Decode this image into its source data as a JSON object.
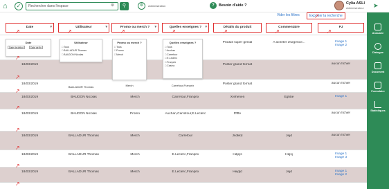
{
  "topbar": {
    "search_placeholder": "Rechercher dans l'espace",
    "admin_label": "Administration",
    "help_label": "Besoin d'aide ?",
    "user_name": "Cylia ASLI",
    "user_role": "Administrateur"
  },
  "links": {
    "reset": "Vider les filtres",
    "export": "Exporter la recherche"
  },
  "columns": [
    "Date",
    "Utilisateur",
    "Promo ou merch ?",
    "Quelles enseignes ?",
    "Détails du produit",
    "Commentaire",
    "PJ"
  ],
  "sidebar": [
    "Annuaire",
    "Dialogue",
    "Document",
    "Formulaire",
    "Statistiques"
  ],
  "filters": {
    "date": {
      "title": "Date",
      "from": "Date de début",
      "to": "Date de fin"
    },
    "user": {
      "title": "Utilisateur",
      "options": [
        "Tous",
        "BALLADUR Thomas",
        "BAUDON Nicolas"
      ]
    },
    "promo": {
      "title": "Promo ou merch ?",
      "options": [
        "Tous",
        "Promo",
        "Merch"
      ]
    },
    "stores": {
      "title": "Quelles enseignes ?",
      "options": [
        "Tous",
        "Auchan",
        "Carrefour",
        "E.Leclerc",
        "Franprix",
        "Casino"
      ]
    }
  },
  "overlay_labels": {
    "user": "BALLADUR Thomas",
    "promo": "Merch",
    "store": "Carrefour,Franprix"
  },
  "rows": [
    {
      "date": "",
      "user": "",
      "type": "",
      "store": "",
      "product": "Produit super genial",
      "comment": "A acheter d'urgence...",
      "pj": [
        "Image 1",
        "Image 2"
      ]
    },
    {
      "date": "18/03/2019",
      "user": "",
      "type": "",
      "store": "",
      "product": "Poster grand format",
      "comment": "",
      "pj": [
        "aucun fichier"
      ]
    },
    {
      "date": "18/03/2019",
      "user": "",
      "type": "",
      "store": "",
      "product": "Poster grand format",
      "comment": "",
      "pj": [
        "aucun fichier"
      ]
    },
    {
      "date": "18/03/2019",
      "user": "BAUDON Nicolas",
      "type": "Merch",
      "store": "Carrefour,Franprix",
      "product": "Xrehenen",
      "comment": "Eghbe",
      "pj": [
        "Image 1"
      ]
    },
    {
      "date": "18/03/2019",
      "user": "BAUDON Nicolas",
      "type": "Promo",
      "store": "Auchan,Carrefour,E.Leclerc",
      "product": "ffffffe",
      "comment": "",
      "pj": [
        "aucun fichier"
      ]
    },
    {
      "date": "18/03/2019",
      "user": "BALLADUR Thomas",
      "type": "Merch",
      "store": "Carrefour",
      "product": "Jsdkkd",
      "comment": "Jejd",
      "pj": [
        "aucun fichier"
      ]
    },
    {
      "date": "18/03/2019",
      "user": "BALLADUR Thomas",
      "type": "Merch",
      "store": "E.Leclerc,Franprix",
      "product": "Hdjejs",
      "comment": "Hdjsj",
      "pj": [
        "Image 1",
        "Image 3"
      ]
    },
    {
      "date": "18/03/2019",
      "user": "BALLADUR Thomas",
      "type": "Merch",
      "store": "E.Leclerc,Franprix",
      "product": "Hejdjd",
      "comment": "Jejd",
      "pj": [
        "Image 1",
        "Image 2"
      ]
    }
  ]
}
